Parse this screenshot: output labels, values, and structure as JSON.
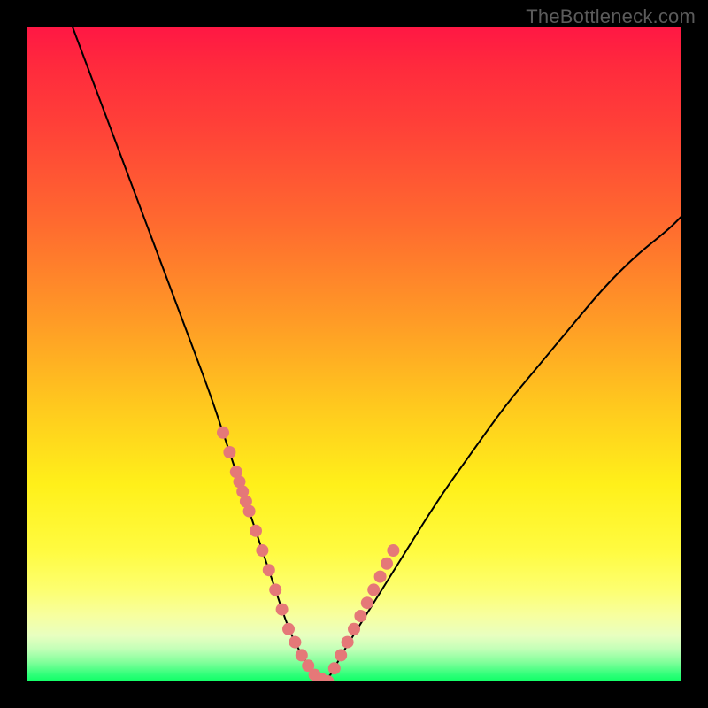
{
  "watermark": "TheBottleneck.com",
  "colors": {
    "frame": "#000000",
    "curve": "#000000",
    "marker": "#e57878",
    "gradient_top": "#ff1744",
    "gradient_bottom": "#10ff66"
  },
  "chart_data": {
    "type": "line",
    "title": "",
    "xlabel": "",
    "ylabel": "",
    "xlim": [
      0,
      100
    ],
    "ylim": [
      0,
      100
    ],
    "series": [
      {
        "name": "bottleneck-curve",
        "x": [
          7,
          10,
          13,
          16,
          19,
          22,
          25,
          28,
          30,
          32,
          34,
          36,
          38,
          40,
          42,
          44,
          46,
          48,
          53,
          58,
          63,
          68,
          73,
          78,
          83,
          88,
          93,
          98,
          100
        ],
        "values": [
          100,
          92,
          84,
          76,
          68,
          60,
          52,
          44,
          38,
          32,
          26,
          20,
          14,
          8,
          4,
          1,
          0,
          4,
          12,
          20,
          28,
          35,
          42,
          48,
          54,
          60,
          65,
          69,
          71
        ]
      }
    ],
    "markers": {
      "name": "highlighted-points",
      "x": [
        30,
        31,
        32,
        32.5,
        33,
        33.5,
        34,
        35,
        36,
        37,
        38,
        39,
        40,
        41,
        42,
        43,
        44,
        45,
        46,
        47,
        48,
        49,
        50,
        51,
        52,
        53,
        54,
        55,
        56
      ],
      "values": [
        38,
        35,
        32,
        30.5,
        29,
        27.5,
        26,
        23,
        20,
        17,
        14,
        11,
        8,
        6,
        4,
        2.4,
        1,
        0.4,
        0,
        2,
        4,
        6,
        8,
        10,
        12,
        14,
        16,
        18,
        20
      ]
    }
  }
}
